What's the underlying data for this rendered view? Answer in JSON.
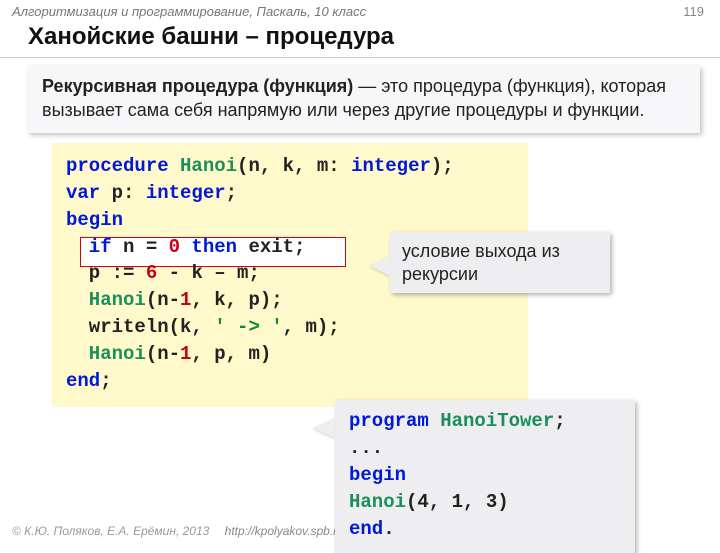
{
  "header": {
    "course": "Алгоритмизация и программирование, Паскаль, 10 класс",
    "page": "119"
  },
  "title": "Ханойские башни – процедура",
  "definition": {
    "term": "Рекурсивная процедура (функция)",
    "rest": " — это процедура (функция), которая вызывает сама себя напрямую или через другие процедуры и функции."
  },
  "code": {
    "l1a": "procedure ",
    "l1b": "Hanoi",
    "l1c": "(n, k, m: ",
    "l1d": "integer",
    "l1e": ");",
    "l2a": "var",
    "l2b": " p: ",
    "l2c": "integer",
    "l2d": ";",
    "l3a": "begin",
    "l4a": "  if ",
    "l4b": "n = ",
    "l4c": "0",
    "l4d": " then ",
    "l4e": "exit;",
    "l5a": "  p := ",
    "l5b": "6",
    "l5c": " - k – m;",
    "l6a": "  Hanoi",
    "l6b": "(n-",
    "l6c": "1",
    "l6d": ", k, p);",
    "l7a": "  writeln(k, ",
    "l7b": "' -> '",
    "l7c": ", m);",
    "l8a": "  Hanoi",
    "l8b": "(n-",
    "l8c": "1",
    "l8d": ", p, m)",
    "l9a": "end",
    "l9b": ";"
  },
  "callout1": "условие выхода из рекурсии",
  "callout2": {
    "l1a": "program ",
    "l1b": "HanoiTower",
    "l1c": ";",
    "l2": "...",
    "l3": "begin",
    "l4a": "  Hanoi",
    "l4b": "(4, 1, 3)",
    "l5a": "end",
    "l5b": "."
  },
  "footer": {
    "copyright": "© К.Ю. Поляков, Е.А. Ерёмин, 2013",
    "url": "http://kpolyakov.spb.ru"
  }
}
